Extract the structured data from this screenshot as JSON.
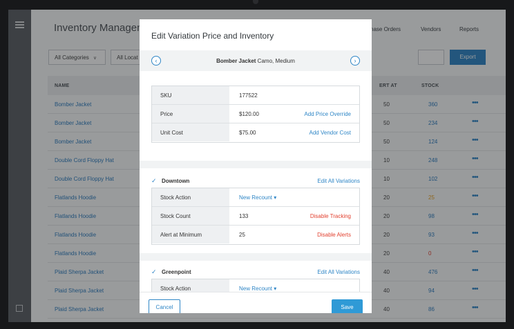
{
  "app": {
    "title": "Inventory Managem",
    "nav": [
      "hase Orders",
      "Vendors",
      "Reports"
    ],
    "filters": {
      "category": "All Categories",
      "location": "All Locat"
    },
    "export_label": "Export",
    "columns": {
      "name": "NAME",
      "alert": "ERT AT",
      "stock": "STOCK"
    },
    "rows": [
      {
        "name": "Bomber Jacket",
        "alert": "50",
        "stock": "360",
        "stock_color": "#2e7dbf"
      },
      {
        "name": "Bomber Jacket",
        "alert": "50",
        "stock": "234",
        "stock_color": "#2e7dbf"
      },
      {
        "name": "Bomber Jacket",
        "alert": "50",
        "stock": "124",
        "stock_color": "#2e7dbf"
      },
      {
        "name": "Double Cord Floppy Hat",
        "alert": "10",
        "stock": "248",
        "stock_color": "#2e7dbf"
      },
      {
        "name": "Double Cord Floppy Hat",
        "alert": "10",
        "stock": "102",
        "stock_color": "#2e7dbf"
      },
      {
        "name": "Flatlands Hoodie",
        "alert": "20",
        "stock": "25",
        "stock_color": "#e8a020"
      },
      {
        "name": "Flatlands Hoodie",
        "alert": "20",
        "stock": "98",
        "stock_color": "#2e7dbf"
      },
      {
        "name": "Flatlands Hoodie",
        "alert": "20",
        "stock": "93",
        "stock_color": "#2e7dbf"
      },
      {
        "name": "Flatlands Hoodie",
        "alert": "20",
        "stock": "0",
        "stock_color": "#e2402f"
      },
      {
        "name": "Plaid Sherpa Jacket",
        "alert": "40",
        "stock": "476",
        "stock_color": "#2e7dbf"
      },
      {
        "name": "Plaid Sherpa Jacket",
        "alert": "40",
        "stock": "94",
        "stock_color": "#2e7dbf"
      },
      {
        "name": "Plaid Sherpa Jacket",
        "alert": "40",
        "stock": "86",
        "stock_color": "#2e7dbf"
      }
    ],
    "row_menu": "•••"
  },
  "modal": {
    "title": "Edit Variation Price and Inventory",
    "variant": {
      "item": "Bomber Jacket",
      "option": "Camo, Medium"
    },
    "prev_icon": "‹",
    "next_icon": "›",
    "details": [
      {
        "label": "SKU",
        "value": "177522",
        "action": ""
      },
      {
        "label": "Price",
        "value": "$120.00",
        "action": "Add Price Override"
      },
      {
        "label": "Unit Cost",
        "value": "$75.00",
        "action": "Add Vendor Cost"
      }
    ],
    "locations": [
      {
        "name": "Downtown",
        "edit_all": "Edit All Variations",
        "stock_action_label": "Stock Action",
        "stock_action_value": "New Recount",
        "stock_count_label": "Stock Count",
        "stock_count_value": "133",
        "stock_count_action": "Disable Tracking",
        "alert_label": "Alert at Minimum",
        "alert_value": "25",
        "alert_action": "Disable Alerts"
      },
      {
        "name": "Greenpoint",
        "edit_all": "Edit All Variations",
        "stock_action_label": "Stock Action",
        "stock_action_value": "New Recount"
      }
    ],
    "cancel_label": "Cancel",
    "save_label": "Save"
  },
  "colors": {
    "accent": "#2f86c6",
    "danger": "#e2402f",
    "warning": "#e8a020"
  }
}
